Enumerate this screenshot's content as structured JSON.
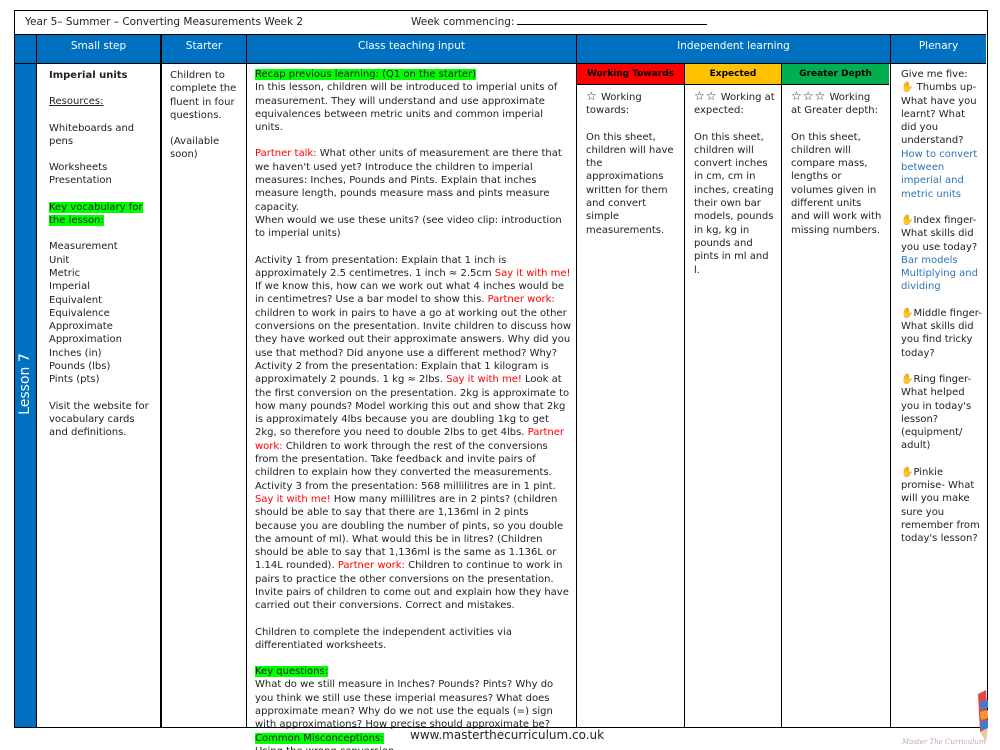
{
  "header": {
    "title": "Year 5– Summer – Converting Measurements  Week 2",
    "week_commencing_label": "Week commencing:"
  },
  "columns": {
    "small_step": "Small step",
    "starter": "Starter",
    "class_teaching": "Class teaching input",
    "independent": "Independent learning",
    "plenary": "Plenary"
  },
  "lesson_label": "Lesson 7",
  "small_step": {
    "title": "Imperial units",
    "resources_label": "Resources:",
    "resources": [
      "Whiteboards and pens",
      "Worksheets",
      "Presentation"
    ],
    "vocab_label_1": "Key vocabulary for",
    "vocab_label_2": "the lesson:",
    "vocabulary": [
      "Measurement",
      "Unit",
      "Metric",
      "Imperial",
      "Equivalent",
      "Equivalence",
      "Approximate",
      "Approximation",
      "Inches (in)",
      "Pounds (lbs)",
      "Pints (pts)"
    ],
    "website_note": "Visit the website for vocabulary cards and definitions."
  },
  "starter": {
    "text": "Children to complete the fluent in four questions.",
    "availability": "(Available soon)"
  },
  "teaching": {
    "recap": "Recap previous learning: (Q1 on the starter)",
    "intro": "In this lesson, children will be introduced to imperial units of measurement. They will understand and use approximate equivalences between metric units and common imperial units.",
    "partner_talk_label": "Partner talk:",
    "partner_talk": " What other units of measurement are there that we haven't used yet? Introduce the children to imperial measures: Inches, Pounds and Pints. Explain that inches measure length, pounds measure mass and pints measure capacity.",
    "when_use": "When would we use these units? (see video clip: introduction to imperial units)",
    "a1_part1": "Activity 1 from presentation: Explain that 1 inch is approximately 2.5 centimetres. 1 inch ≈ 2.5cm ",
    "say_it": "Say it with me!",
    "a1_part2": " If we know this, how can we work out what 4 inches would be in centimetres? Use a bar model to show this. ",
    "partner_work": "Partner work:",
    "a1_part3": " children to work in pairs to have a go at working out the other conversions on the presentation. Invite children to discuss how they have worked out their approximate answers. Why did you use that method? Did anyone use a different method? Why?",
    "a2_part1": "Activity 2 from the presentation: Explain that 1 kilogram is approximately 2 pounds. 1 kg ≈ 2lbs. ",
    "a2_part2": " Look at the first conversion on the presentation. 2kg is approximate to  how many pounds? Model working this out  and show that 2kg is approximately 4lbs because you are doubling 1kg to get 2kg, so therefore you need to double 2lbs to get 4lbs. ",
    "a2_part3": " Children to work through the rest of the conversions from the presentation. Take feedback and invite pairs of children to explain how they converted the measurements.",
    "a3_part1": "Activity 3 from the presentation: 568 millilitres are in 1 pint. ",
    "a3_part2": " How many millilitres are in 2 pints? (children should be able to say that there are 1,136ml in 2 pints because you are doubling the number of pints, so you double the amount of ml). What would this be in litres? (Children should be able to say that 1,136ml is the same as 1.136L or 1.14L rounded). ",
    "a3_part3": " Children to continue to work in pairs to practice the other conversions on the presentation. Invite pairs of children to come out and explain how they have carried out their conversions. Correct and mistakes.",
    "independent_note": "Children to complete the independent activities via differentiated worksheets.",
    "key_questions_label": "Key questions:",
    "key_questions": "What do we still measure in Inches? Pounds? Pints? Why do you think we still use these imperial measures? What does approximate mean? Why do we not use the equals (=) sign with approximations? How precise should approximate be?",
    "misconceptions_label": "Common Misconceptions:",
    "misconceptions": "Using the wrong conversion"
  },
  "independent": {
    "working_towards": {
      "band": "Working Towards",
      "stars": "☆",
      "heading": "Working towards:",
      "text": "On this sheet, children will have the approximations written for them and convert simple measurements."
    },
    "expected": {
      "band": "Expected",
      "stars": "☆☆",
      "heading": "Working at expected:",
      "text": "On this sheet, children will convert inches in cm, cm in inches, creating their own bar models, pounds in kg, kg in pounds and pints in ml and l."
    },
    "greater_depth": {
      "band": "Greater Depth",
      "stars": "☆☆☆",
      "heading": "Working at Greater depth:",
      "text": "On this sheet, children will compare mass, lengths or volumes given in different units and will work with missing numbers."
    }
  },
  "plenary": {
    "intro": "Give me five:",
    "thumb": "Thumbs up- What have you learnt? What did you understand?",
    "thumb_answer": "How to convert between imperial and metric units",
    "index": "Index finger- What skills did you use today?",
    "index_answer": "Bar models Multiplying and dividing",
    "middle": "Middle finger- What skills did you find tricky today?",
    "ring": "Ring finger- What helped you in today's lesson? (equipment/ adult)",
    "pinkie": "Pinkie promise- What will you make sure you remember from today's lesson?"
  },
  "footer": {
    "url": "www.masterthecurriculum.co.uk",
    "logo_text": "Master The Curriculum"
  }
}
